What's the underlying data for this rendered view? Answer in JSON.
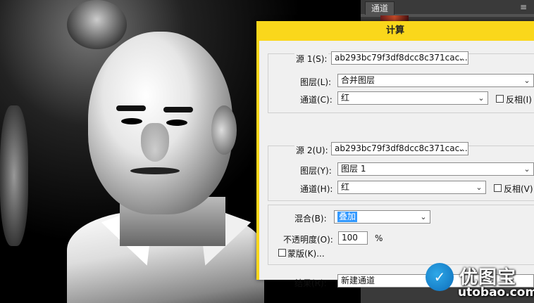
{
  "panel": {
    "tab_label": "通道",
    "menu_icon": "panel-menu-icon"
  },
  "dialog": {
    "title": "计算",
    "source1": {
      "label": "源 1(S):",
      "value": "ab293bc79f3df8dcc8c371cac...",
      "layer_label": "图层(L):",
      "layer_value": "合并图层",
      "channel_label": "通道(C):",
      "channel_value": "红",
      "invert_label": "反相(I)"
    },
    "source2": {
      "label": "源 2(U):",
      "value": "ab293bc79f3df8dcc8c371cac...",
      "layer_label": "图层(Y):",
      "layer_value": "图层 1",
      "channel_label": "通道(H):",
      "channel_value": "红",
      "invert_label": "反相(V)"
    },
    "blend": {
      "label": "混合(B):",
      "value": "叠加",
      "opacity_label": "不透明度(O):",
      "opacity_value": "100",
      "opacity_unit": "%",
      "mask_label": "蒙版(K)..."
    },
    "result": {
      "label": "结果(R):",
      "value": "新建通道"
    }
  },
  "watermark": {
    "name": "优图宝",
    "url": "utobao.com"
  },
  "colors": {
    "dialog_title_bar": "#fad71b",
    "dialog_body": "#f0f0f0",
    "selection": "#3399ff",
    "panel_bg": "#3a3a3a"
  }
}
